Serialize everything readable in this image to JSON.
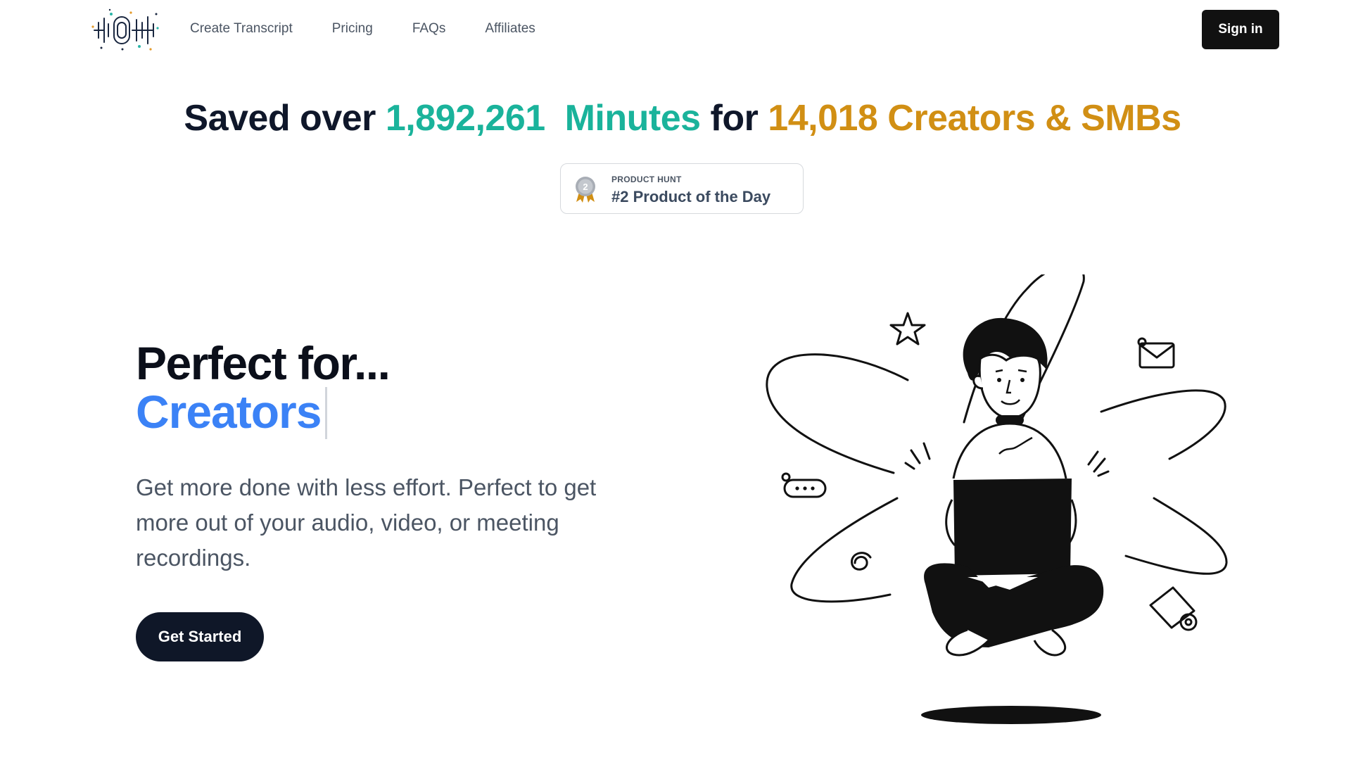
{
  "header": {
    "logo_icon": "soundwave-logo-icon",
    "nav": [
      {
        "label": "Create Transcript"
      },
      {
        "label": "Pricing"
      },
      {
        "label": "FAQs"
      },
      {
        "label": "Affiliates"
      }
    ],
    "signin_label": "Sign in"
  },
  "stats": {
    "prefix": "Saved over",
    "minutes_count": "1,892,261",
    "minutes_label": "Minutes",
    "for_label": "for",
    "creators_count": "14,018",
    "creators_label": "Creators & SMBs"
  },
  "badge": {
    "source": "PRODUCT HUNT",
    "title": "#2 Product of the Day",
    "medal_number": "2"
  },
  "hero": {
    "title": "Perfect for...",
    "rotating_word": "Creators",
    "description": "Get more done with less effort. Perfect to get more out of your audio, video, or meeting recordings.",
    "cta_label": "Get Started"
  },
  "colors": {
    "teal": "#1ab39b",
    "gold": "#d18f14",
    "blue": "#3b82f6",
    "dark_button": "#0f1728"
  }
}
